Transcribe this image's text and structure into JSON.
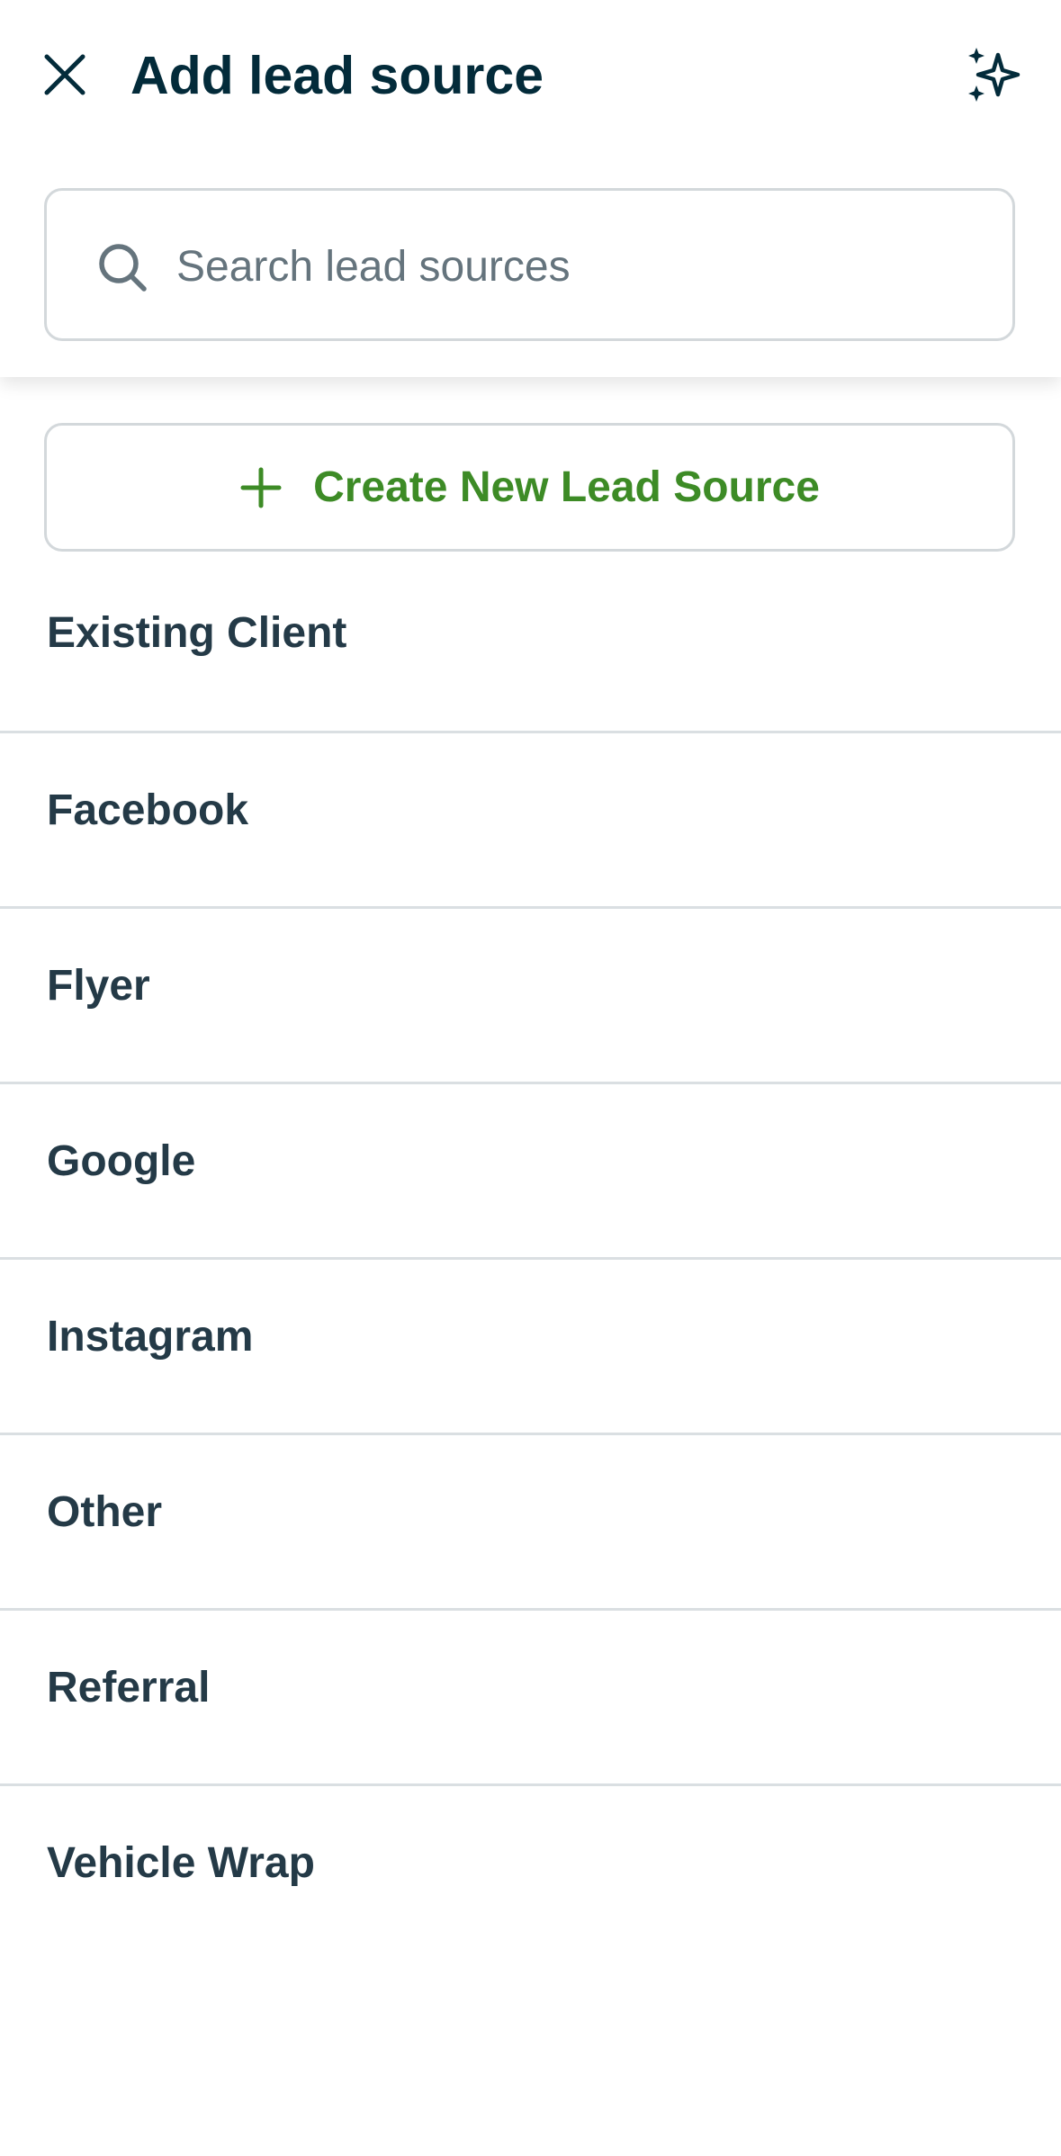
{
  "header": {
    "title": "Add lead source",
    "close_icon": "close-icon",
    "sparkle_icon": "sparkle-icon"
  },
  "search": {
    "placeholder": "Search lead sources",
    "value": "",
    "icon": "search-icon"
  },
  "create_button": {
    "label": "Create New Lead Source",
    "icon": "plus-icon",
    "color": "#3d8b26"
  },
  "lead_sources": [
    "Existing Client",
    "Facebook",
    "Flyer",
    "Google",
    "Instagram",
    "Other",
    "Referral",
    "Vehicle Wrap"
  ],
  "colors": {
    "title": "#032b3a",
    "item_text": "#243a47",
    "border": "#d3d8db",
    "accent": "#3d8b26"
  }
}
